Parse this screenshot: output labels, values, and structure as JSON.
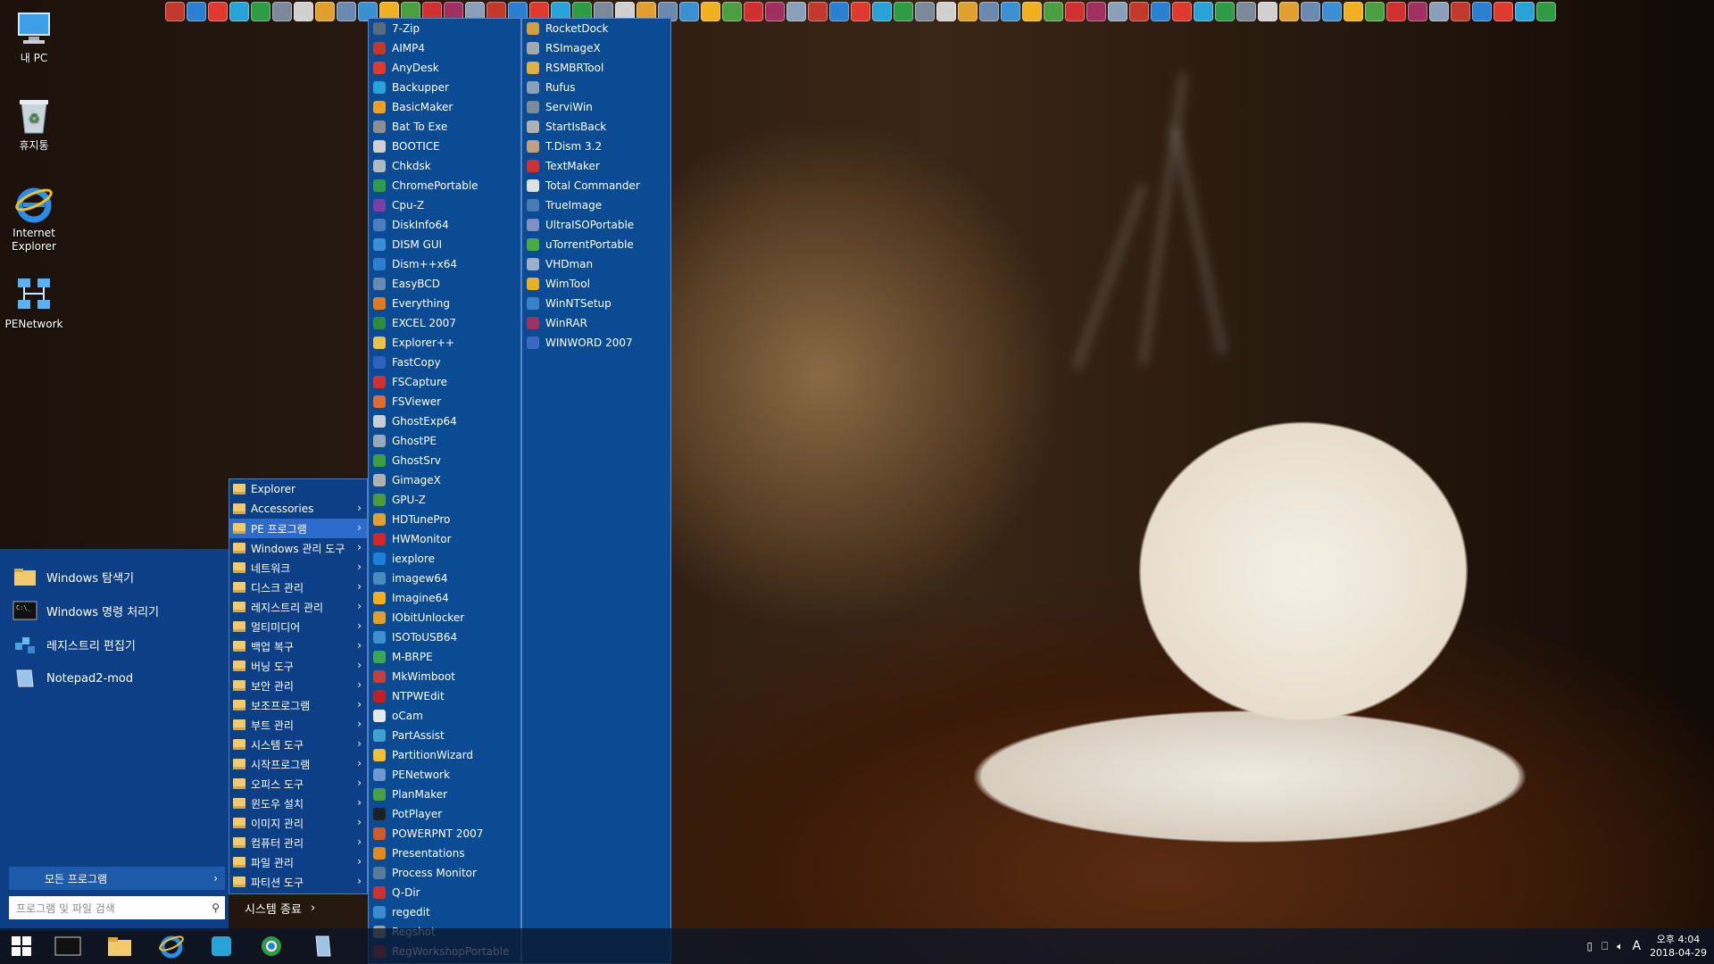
{
  "desktop_icons": [
    {
      "label": "내 PC",
      "icon": "computer-icon"
    },
    {
      "label": "휴지통",
      "icon": "recycle-bin-icon"
    },
    {
      "label": "Internet Explorer",
      "icon": "ie-icon"
    },
    {
      "label": "PENetwork",
      "icon": "network-icon"
    }
  ],
  "toolbar_icon_count": 65,
  "colors": {
    "menu_bg": "#0d3f86",
    "program_bg": "#0b4b93",
    "selected": "#2d6ccc",
    "taskbar": "#0a1428"
  },
  "start_menu": {
    "pinned": [
      {
        "label": "Windows 탐색기",
        "icon": "folder-icon"
      },
      {
        "label": "Windows 명령 처리기",
        "icon": "cmd-icon"
      },
      {
        "label": "레지스트리 편집기",
        "icon": "regedit-icon"
      },
      {
        "label": "Notepad2-mod",
        "icon": "notepad-icon"
      }
    ],
    "all_programs": "모든 프로그램",
    "search_placeholder": "프로그램 및 파일 검색",
    "shutdown": "시스템 종료"
  },
  "folder_menu": [
    {
      "label": "Explorer",
      "arrow": false,
      "selected": false
    },
    {
      "label": "Accessories",
      "arrow": true,
      "selected": false
    },
    {
      "label": "PE 프로그램",
      "arrow": true,
      "selected": true
    },
    {
      "label": "Windows 관리 도구",
      "arrow": true,
      "selected": false
    },
    {
      "label": "네트워크",
      "arrow": true,
      "selected": false
    },
    {
      "label": "디스크 관리",
      "arrow": true,
      "selected": false
    },
    {
      "label": "레지스트리 관리",
      "arrow": true,
      "selected": false
    },
    {
      "label": "멀티미디어",
      "arrow": true,
      "selected": false
    },
    {
      "label": "백업 복구",
      "arrow": true,
      "selected": false
    },
    {
      "label": "버닝 도구",
      "arrow": true,
      "selected": false
    },
    {
      "label": "보안 관리",
      "arrow": true,
      "selected": false
    },
    {
      "label": "보조프로그램",
      "arrow": true,
      "selected": false
    },
    {
      "label": "부트 관리",
      "arrow": true,
      "selected": false
    },
    {
      "label": "시스템 도구",
      "arrow": true,
      "selected": false
    },
    {
      "label": "시작프로그램",
      "arrow": true,
      "selected": false
    },
    {
      "label": "오피스 도구",
      "arrow": true,
      "selected": false
    },
    {
      "label": "윈도우 설치",
      "arrow": true,
      "selected": false
    },
    {
      "label": "이미지 관리",
      "arrow": true,
      "selected": false
    },
    {
      "label": "컴퓨터 관리",
      "arrow": true,
      "selected": false
    },
    {
      "label": "파일 관리",
      "arrow": true,
      "selected": false
    },
    {
      "label": "파티션 도구",
      "arrow": true,
      "selected": false
    }
  ],
  "programs_col1": [
    {
      "label": "7-Zip",
      "color": "#5a6b7d"
    },
    {
      "label": "AIMP4",
      "color": "#c0392b"
    },
    {
      "label": "AnyDesk",
      "color": "#e03a2f"
    },
    {
      "label": "Backupper",
      "color": "#27a3d8"
    },
    {
      "label": "BasicMaker",
      "color": "#f0a020"
    },
    {
      "label": "Bat To Exe",
      "color": "#8e8e8e"
    },
    {
      "label": "BOOTICE",
      "color": "#d0d0d0"
    },
    {
      "label": "Chkdsk",
      "color": "#b0b8c0"
    },
    {
      "label": "ChromePortable",
      "color": "#2e9b45"
    },
    {
      "label": "Cpu-Z",
      "color": "#7a3fa0"
    },
    {
      "label": "DiskInfo64",
      "color": "#4a7fc0"
    },
    {
      "label": "DISM GUI",
      "color": "#3a8fd8"
    },
    {
      "label": "Dism++x64",
      "color": "#2f7fd0"
    },
    {
      "label": "EasyBCD",
      "color": "#6a8ab0"
    },
    {
      "label": "Everything",
      "color": "#e07a20"
    },
    {
      "label": "EXCEL 2007",
      "color": "#2e8b3e"
    },
    {
      "label": "Explorer++",
      "color": "#e8c24a"
    },
    {
      "label": "FastCopy",
      "color": "#3060c0"
    },
    {
      "label": "FSCapture",
      "color": "#d03030"
    },
    {
      "label": "FSViewer",
      "color": "#e06a30"
    },
    {
      "label": "GhostExp64",
      "color": "#c8d0d8"
    },
    {
      "label": "GhostPE",
      "color": "#9aa8b8"
    },
    {
      "label": "GhostSrv",
      "color": "#3aa040"
    },
    {
      "label": "GimageX",
      "color": "#b0b0b0"
    },
    {
      "label": "GPU-Z",
      "color": "#4a9a40"
    },
    {
      "label": "HDTunePro",
      "color": "#e0a030"
    },
    {
      "label": "HWMonitor",
      "color": "#d02828"
    },
    {
      "label": "iexplore",
      "color": "#1e7fd8"
    },
    {
      "label": "imagew64",
      "color": "#4a8ac0"
    },
    {
      "label": "Imagine64",
      "color": "#f0b020"
    },
    {
      "label": "IObitUnlocker",
      "color": "#e0a028"
    },
    {
      "label": "ISOToUSB64",
      "color": "#3a90d0"
    },
    {
      "label": "M-BRPE",
      "color": "#3aa850"
    },
    {
      "label": "MkWimboot",
      "color": "#c04040"
    },
    {
      "label": "NTPWEdit",
      "color": "#c02020"
    },
    {
      "label": "oCam",
      "color": "#e8e8e8"
    },
    {
      "label": "PartAssist",
      "color": "#40a0d0"
    },
    {
      "label": "PartitionWizard",
      "color": "#f0c030"
    },
    {
      "label": "PENetwork",
      "color": "#6a9ad0"
    },
    {
      "label": "PlanMaker",
      "color": "#4aa040"
    },
    {
      "label": "PotPlayer",
      "color": "#202020"
    },
    {
      "label": "POWERPNT 2007",
      "color": "#d05a28"
    },
    {
      "label": "Presentations",
      "color": "#e08a20"
    },
    {
      "label": "Process Monitor",
      "color": "#5a7a9a"
    },
    {
      "label": "Q-Dir",
      "color": "#d03030"
    },
    {
      "label": "regedit",
      "color": "#3a8ad0"
    },
    {
      "label": "Regshot",
      "color": "#a0a0a0"
    },
    {
      "label": "RegWorkshopPortable",
      "color": "#c04030"
    }
  ],
  "programs_col2": [
    {
      "label": "RocketDock",
      "color": "#d0a040"
    },
    {
      "label": "RSImageX",
      "color": "#a0a8b0"
    },
    {
      "label": "RSMBRTool",
      "color": "#e0b040"
    },
    {
      "label": "Rufus",
      "color": "#8aa0b8"
    },
    {
      "label": "ServiWin",
      "color": "#7a8a9a"
    },
    {
      "label": "StartIsBack",
      "color": "#b0b0b0"
    },
    {
      "label": "T.Dism 3.2",
      "color": "#c0a080"
    },
    {
      "label": "TextMaker",
      "color": "#d03030"
    },
    {
      "label": "Total Commander",
      "color": "#e0e0e0"
    },
    {
      "label": "TrueImage",
      "color": "#4a7ab0"
    },
    {
      "label": "UltraISOPortable",
      "color": "#8090c0"
    },
    {
      "label": "uTorrentPortable",
      "color": "#4aaa40"
    },
    {
      "label": "VHDman",
      "color": "#9ab0c8"
    },
    {
      "label": "WimTool",
      "color": "#e8b020"
    },
    {
      "label": "WinNTSetup",
      "color": "#3a80c8"
    },
    {
      "label": "WinRAR",
      "color": "#a03060"
    },
    {
      "label": "WINWORD 2007",
      "color": "#3a6ac0"
    }
  ],
  "taskbar": {
    "buttons": [
      "start-button",
      "cmd-button",
      "explorer-button",
      "ie-button",
      "backupper-button",
      "chrome-button",
      "notepad-button"
    ],
    "clock_time": "오후 4:04",
    "clock_date": "2018-04-29",
    "ime": "A"
  }
}
